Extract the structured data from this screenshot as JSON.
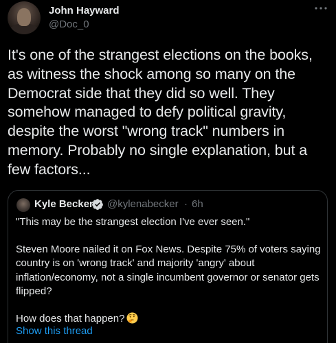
{
  "author": {
    "display_name": "John Hayward",
    "handle": "@Doc_0"
  },
  "tweet": {
    "text": "It's one of the strangest elections on the books, as witness the shock among so many on the Democrat side that they did so well. They somehow managed to defy political gravity, despite the worst \"wrong track\" numbers in memory. Probably no single explanation, but a few factors..."
  },
  "quoted_tweet": {
    "display_name": "Kyle Becker",
    "verified": true,
    "handle": "@kylenabecker",
    "separator": "·",
    "time": "6h",
    "paragraphs": [
      "\"This may be the strangest election I've ever seen.\"",
      "Steven Moore nailed it on Fox News. Despite 75% of voters saying country is on 'wrong track' and majority 'angry' about inflation/economy, not a single incumbent governor or senator gets flipped?",
      "How does that happen?"
    ],
    "show_thread_label": "Show this thread"
  },
  "colors": {
    "background": "#000000",
    "primary_text": "#e7e9ea",
    "secondary_text": "#71767b",
    "link_blue": "#1d9bf0",
    "border": "#2f3336"
  },
  "icons": {
    "more": "more-dots-icon",
    "verified": "verified-badge-icon",
    "emoji": "thinking-face-emoji"
  }
}
